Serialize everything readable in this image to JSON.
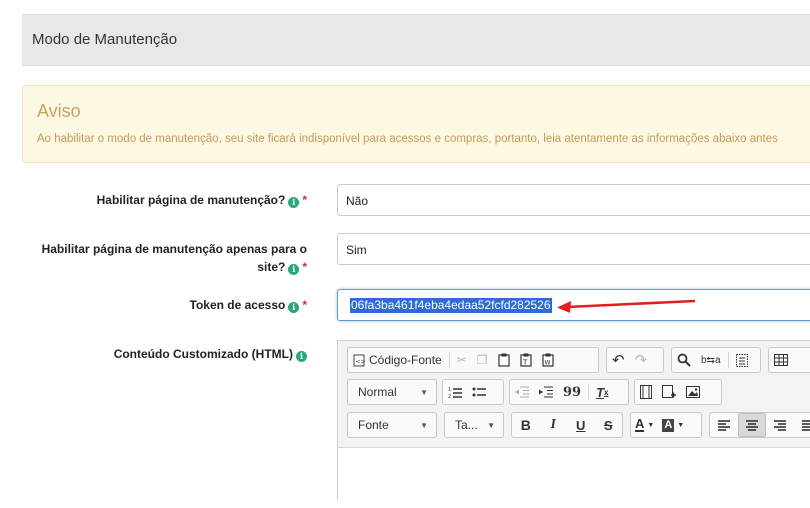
{
  "header": {
    "title": "Modo de Manutenção"
  },
  "alert": {
    "title": "Aviso",
    "text": "Ao habilitar o modo de manutenção, seu site ficará indisponível para acessos e compras, portanto, leia atentamente as informações abaixo antes"
  },
  "form": {
    "maintenance_label": "Habilitar página de manutenção?",
    "maintenance_value": "Não",
    "site_only_label_1": "Habilitar página de manutenção apenas para o",
    "site_only_label_2": "site?",
    "site_only_value": "Sim",
    "token_label": "Token de acesso",
    "token_value": "06fa3ba461f4eba4edaa52fcfd282526",
    "content_label": "Conteúdo Customizado (HTML)",
    "required_mark": "*",
    "info_glyph": "i"
  },
  "editor": {
    "source_label": "Código-Fonte",
    "format_value": "Normal",
    "font_value": "Fonte",
    "size_value": "Ta...",
    "bold": "B",
    "italic": "I",
    "underline": "U",
    "strike": "S",
    "blockquote": "99",
    "text_color": "A",
    "bg_color": "A"
  },
  "colors": {
    "alert_bg": "#fcf8e3",
    "alert_text": "#c49a56",
    "info_icon": "#2ba77e",
    "required": "#d32f2f",
    "arrow": "#e02020",
    "selection": "#2e6ad8"
  }
}
